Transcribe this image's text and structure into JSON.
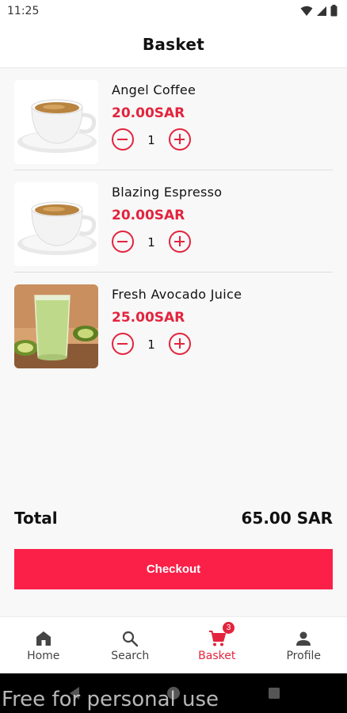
{
  "status_bar": {
    "time": "11:25"
  },
  "header": {
    "title": "Basket"
  },
  "cart_items": [
    {
      "name": "Angel Coffee",
      "price": "20.00SAR",
      "quantity": "1",
      "image": "coffee-cup"
    },
    {
      "name": "Blazing Espresso",
      "price": "20.00SAR",
      "quantity": "1",
      "image": "coffee-cup"
    },
    {
      "name": "Fresh Avocado Juice",
      "price": "25.00SAR",
      "quantity": "1",
      "image": "avocado-juice"
    }
  ],
  "summary": {
    "total_label": "Total",
    "total_value": "65.00 SAR"
  },
  "checkout": {
    "label": "Checkout"
  },
  "bottom_nav": {
    "items": [
      {
        "label": "Home",
        "icon": "home-icon"
      },
      {
        "label": "Search",
        "icon": "search-icon"
      },
      {
        "label": "Basket",
        "icon": "cart-icon",
        "badge": "3",
        "active": true
      },
      {
        "label": "Profile",
        "icon": "person-icon"
      }
    ]
  },
  "watermark": "Free for personal use",
  "colors": {
    "accent": "#e3243d",
    "button": "#fa2047",
    "background": "#f8f8f8"
  }
}
